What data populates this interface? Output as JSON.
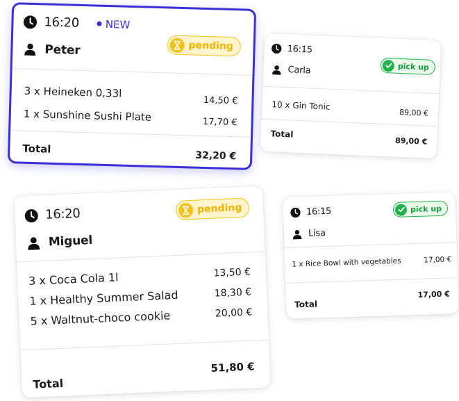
{
  "orders": [
    {
      "time": "16:20",
      "customer": "Peter",
      "new_label": "NEW",
      "status": "pending",
      "items": [
        {
          "text": "3 x Heineken 0,33l",
          "price": "14,50 €"
        },
        {
          "text": "1 x Sunshine Sushi Plate",
          "price": "17,70 €"
        }
      ],
      "total_label": "Total",
      "total": "32,20 €"
    },
    {
      "time": "16:15",
      "customer": "Carla",
      "status": "pick up",
      "items": [
        {
          "text": "10 x Gin Tonic",
          "price": "89,00 €"
        }
      ],
      "total_label": "Total",
      "total": "89,00 €"
    },
    {
      "time": "16:20",
      "customer": "Miguel",
      "status": "pending",
      "items": [
        {
          "text": "3 x Coca Cola 1l",
          "price": "13,50 €"
        },
        {
          "text": "1 x Healthy Summer Salad",
          "price": "18,30 €"
        },
        {
          "text": "5 x Waltnut-choco cookie",
          "price": "20,00 €"
        }
      ],
      "total_label": "Total",
      "total": "51,80 €"
    },
    {
      "time": "16:15",
      "customer": "Lisa",
      "status": "pick up",
      "items": [
        {
          "text": "1 x Rice Bowl with vegetables",
          "price": "17,00 €"
        }
      ],
      "total_label": "Total",
      "total": "17,00 €"
    }
  ],
  "colors": {
    "selected_border": "#3b2fd6",
    "pending": "#f2c21c",
    "pickup": "#22b24c"
  },
  "icons": {
    "time": "clock-icon",
    "customer": "person-icon",
    "pending": "hourglass-icon",
    "pickup": "check-circle-icon"
  }
}
